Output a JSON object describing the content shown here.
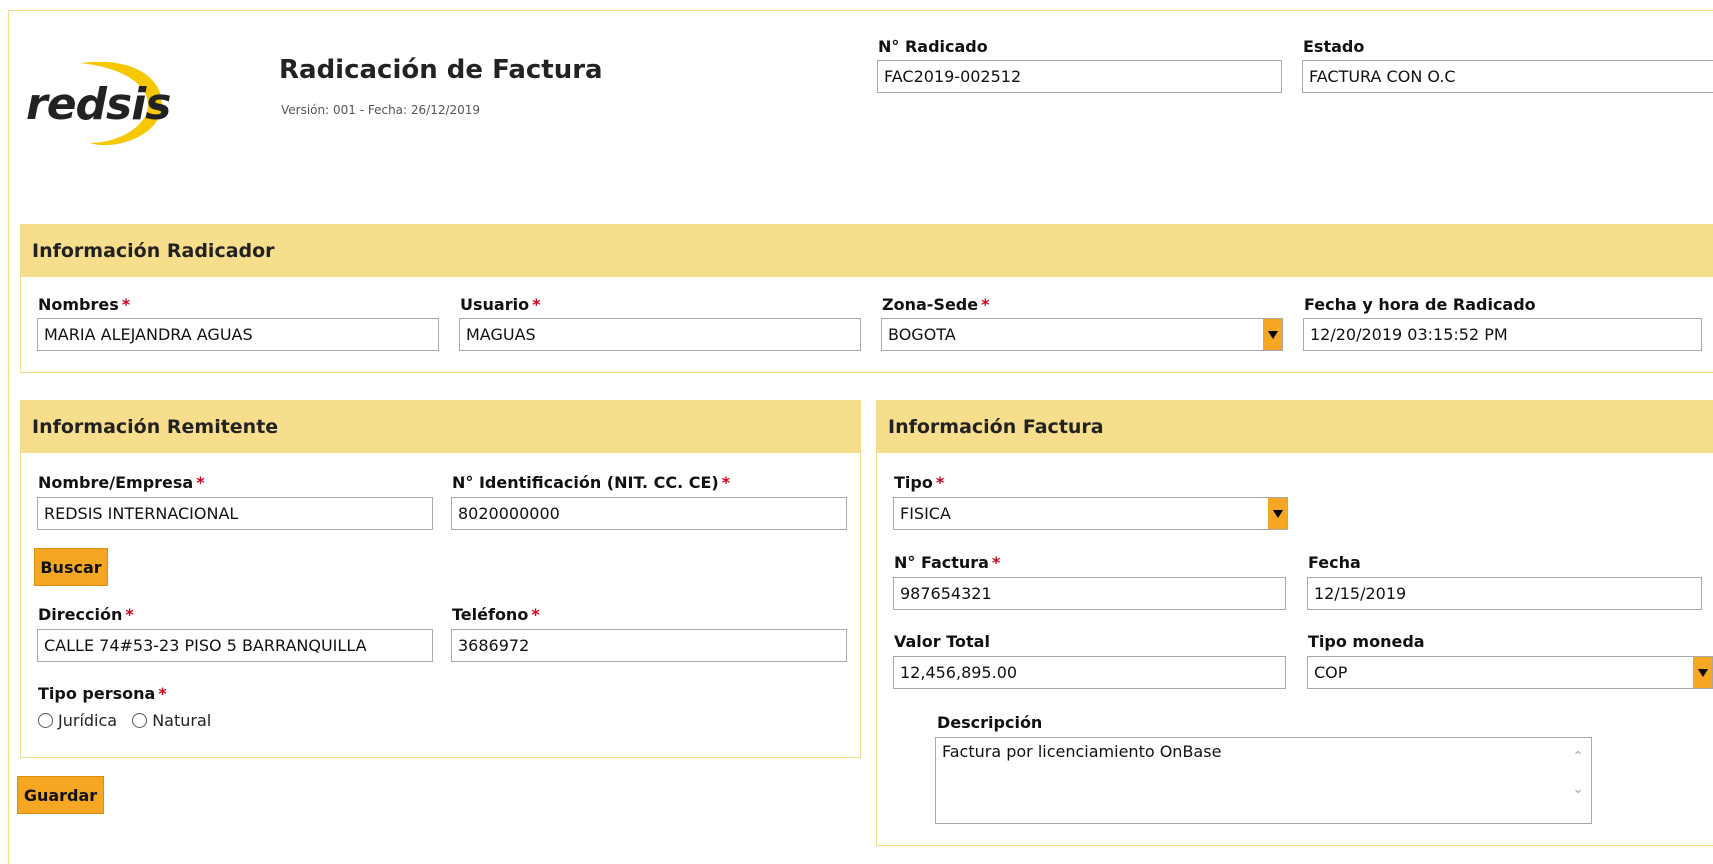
{
  "header": {
    "logo_text": "redsis",
    "title": "Radicación de Factura",
    "subtitle": "Versión: 001 - Fecha: 26/12/2019",
    "radicado_label": "N° Radicado",
    "radicado_value": "FAC2019-002512",
    "estado_label": "Estado",
    "estado_value": "FACTURA CON O.C"
  },
  "radicador": {
    "heading": "Información Radicador",
    "nombres_label": "Nombres",
    "nombres_value": "MARIA ALEJANDRA AGUAS",
    "usuario_label": "Usuario",
    "usuario_value": "MAGUAS",
    "zona_label": "Zona-Sede",
    "zona_value": "BOGOTA",
    "fecha_label": "Fecha y hora de Radicado",
    "fecha_value": "12/20/2019 03:15:52 PM"
  },
  "remitente": {
    "heading": "Información Remitente",
    "empresa_label": "Nombre/Empresa",
    "empresa_value": "REDSIS INTERNACIONAL",
    "id_label": "N° Identificación (NIT. CC. CE)",
    "id_value": "8020000000",
    "buscar_label": "Buscar",
    "direccion_label": "Dirección",
    "direccion_value": "CALLE 74#53-23 PISO 5 BARRANQUILLA",
    "telefono_label": "Teléfono",
    "telefono_value": "3686972",
    "tipo_persona_label": "Tipo persona",
    "opt_juridica": "Jurídica",
    "opt_natural": "Natural"
  },
  "factura": {
    "heading": "Información Factura",
    "tipo_label": "Tipo",
    "tipo_value": "FISICA",
    "numero_label": "N° Factura",
    "numero_value": "987654321",
    "fecha_label": "Fecha",
    "fecha_value": "12/15/2019",
    "valor_label": "Valor Total",
    "valor_value": "12,456,895.00",
    "moneda_label": "Tipo moneda",
    "moneda_value": "COP",
    "descripcion_label": "Descripción",
    "descripcion_value": "Factura por licenciamiento OnBase"
  },
  "actions": {
    "guardar_label": "Guardar"
  },
  "required_mark": "*",
  "colors": {
    "accent": "#f5a623",
    "panel_header": "#f7de8c",
    "panel_border": "#f3dc8a",
    "required": "#d0021b"
  }
}
